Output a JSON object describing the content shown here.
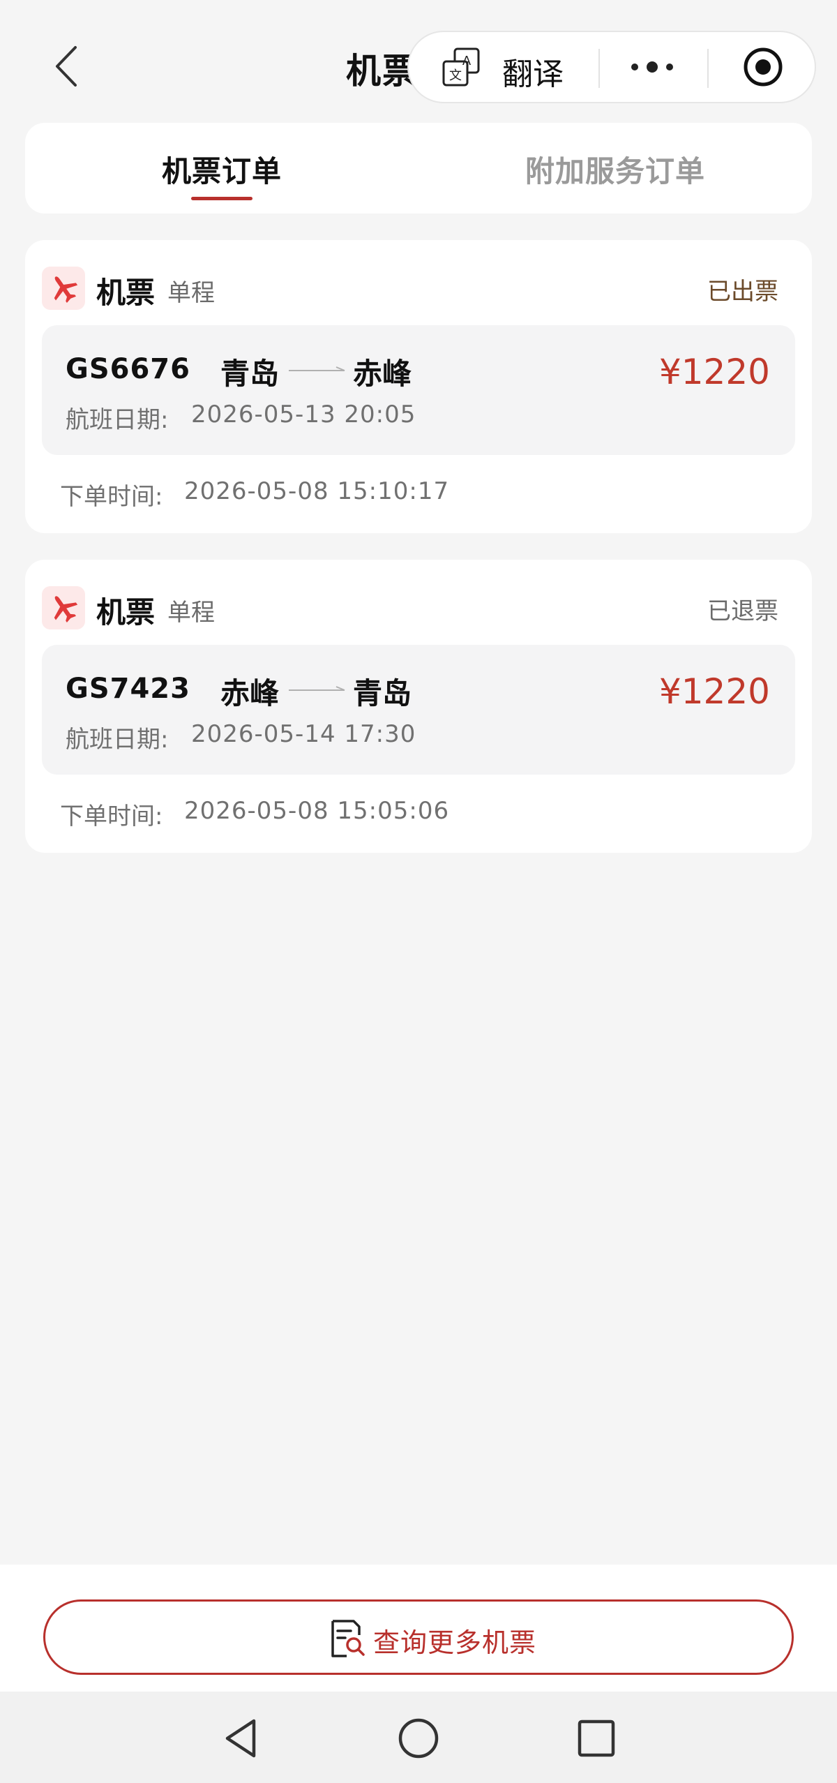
{
  "header": {
    "title": "机票",
    "capsule": {
      "translate_label": "翻译",
      "translate_icon": "translate-icon",
      "more_icon": "more-dots-icon",
      "close_icon": "miniprogram-close-icon"
    },
    "back_icon": "chevron-left-icon"
  },
  "tabs": [
    {
      "label": "机票订单",
      "active": true
    },
    {
      "label": "附加服务订单",
      "active": false
    }
  ],
  "orders": [
    {
      "kind": "机票",
      "trip_type": "单程",
      "status": "已出票",
      "flight_no": "GS6676",
      "from": "青岛",
      "to": "赤峰",
      "price": "¥1220",
      "flight_date_label": "航班日期:",
      "flight_date": "2026-05-13 20:05",
      "order_time_label": "下单时间:",
      "order_time": "2026-05-08 15:10:17"
    },
    {
      "kind": "机票",
      "trip_type": "单程",
      "status": "已退票",
      "flight_no": "GS7423",
      "from": "赤峰",
      "to": "青岛",
      "price": "¥1220",
      "flight_date_label": "航班日期:",
      "flight_date": "2026-05-14 17:30",
      "order_time_label": "下单时间:",
      "order_time": "2026-05-08 15:05:06"
    }
  ],
  "bottom": {
    "query_label": "查询更多机票",
    "query_icon": "search-document-icon"
  },
  "system_nav": {
    "back_icon": "triangle-back-icon",
    "home_icon": "circle-home-icon",
    "recents_icon": "square-recents-icon"
  },
  "colors": {
    "accent": "#b8302c",
    "price": "#c0392b",
    "background": "#f5f5f5",
    "status_issued": "#6b4a2a"
  }
}
